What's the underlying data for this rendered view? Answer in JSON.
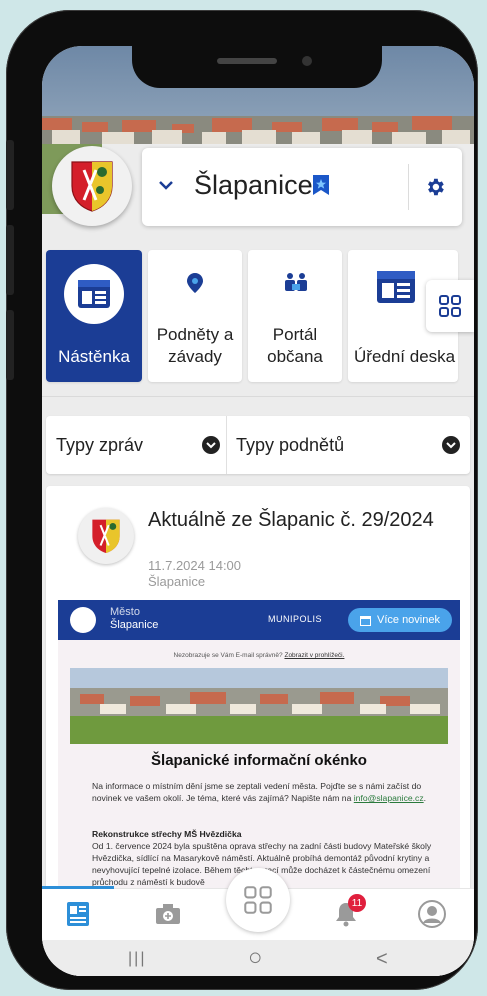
{
  "header": {
    "city_name": "Šlapanice",
    "dropdown_icon": "chevron-down-icon",
    "bookmark_icon": "bookmark-star-icon",
    "settings_icon": "gear-icon"
  },
  "tiles": [
    {
      "id": "nastenka",
      "label_lines": [
        "Nástěnka"
      ],
      "icon": "board-icon",
      "active": true
    },
    {
      "id": "podnety",
      "label_lines": [
        "Podněty a",
        "závady"
      ],
      "icon": "map-pin-icon",
      "active": false
    },
    {
      "id": "portal",
      "label_lines": [
        "Portál",
        "občana"
      ],
      "icon": "people-icon",
      "active": false
    },
    {
      "id": "uredni",
      "label_lines": [
        "Úřední deska"
      ],
      "icon": "notice-board-icon",
      "active": false
    }
  ],
  "filters": {
    "message_types": "Typy zpráv",
    "report_types": "Typy podnětů"
  },
  "post": {
    "title": "Aktuálně ze Šlapanic č. 29/2024",
    "datetime": "11.7.2024 14:00",
    "source": "Šlapanice",
    "email": {
      "header_line1": "Město",
      "header_line2": "Šlapanice",
      "brand": "MUNIPOLIS",
      "more_button": "Více novinek",
      "notice_text": "Nezobrazuje se Vám E-mail správně?",
      "notice_link": "Zobrazit v prohlížeči.",
      "title": "Šlapanické informační okénko",
      "intro": "Na informace o místním dění jsme se zeptali vedení města. Pojďte se s námi začíst do novinek ve vašem okolí. Je téma, které vás zajímá? Napište nám na",
      "intro_email": "info@slapanice.cz",
      "intro_end": ".",
      "section_heading": "Rekonstrukce střechy MŠ Hvězdička",
      "section_text": "Od 1. července 2024 byla spuštěna oprava střechy na zadní části budovy Mateřské školy Hvězdička, sídlící na Masarykově náměstí. Aktuálně probíhá demontáž původní krytiny a nevyhovující tepelné izolace. Během těchto prací může docházet k částečnému omezení průchodu z náměstí k budově"
    }
  },
  "bottom_nav": {
    "items": [
      "board-icon",
      "camera-icon",
      "apps-grid-icon",
      "bell-icon",
      "account-icon"
    ],
    "notification_count": "11"
  },
  "system_nav": {
    "recents": "|||",
    "home": "○",
    "back": "<"
  },
  "colors": {
    "primary": "#1b3d95",
    "accent": "#4aa3ea",
    "badge": "#e01f3d",
    "background": "#ececec"
  }
}
